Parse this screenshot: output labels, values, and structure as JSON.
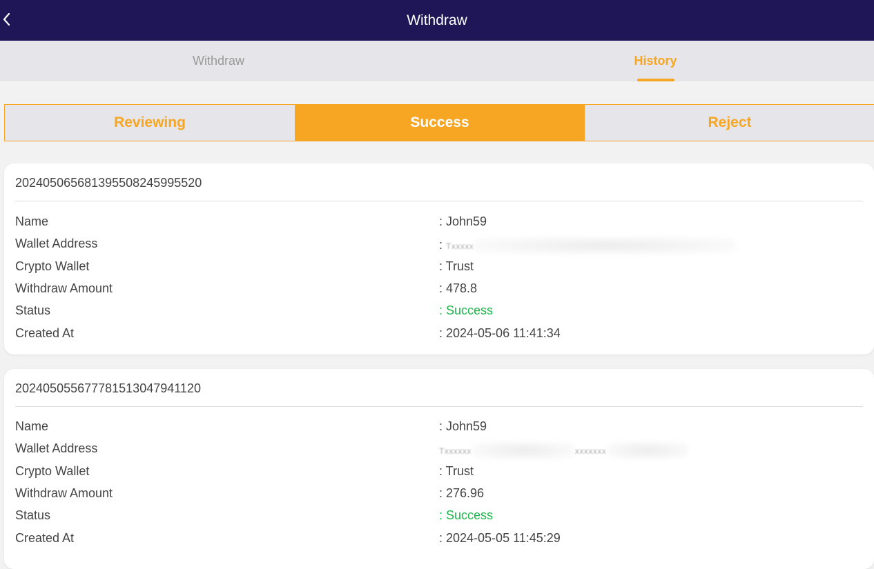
{
  "header": {
    "title": "Withdraw"
  },
  "main_tabs": [
    {
      "label": "Withdraw",
      "active": false
    },
    {
      "label": "History",
      "active": true
    }
  ],
  "sub_tabs": [
    {
      "label": "Reviewing",
      "active": false
    },
    {
      "label": "Success",
      "active": true
    },
    {
      "label": "Reject",
      "active": false
    }
  ],
  "labels": {
    "name": "Name",
    "wallet_address": "Wallet Address",
    "crypto_wallet": "Crypto Wallet",
    "withdraw_amount": "Withdraw Amount",
    "status": "Status",
    "created_at": "Created At"
  },
  "records": [
    {
      "id": "20240506568139550824599552​0",
      "name": ": John59",
      "wallet_address": ": ",
      "crypto_wallet": ": Trust",
      "withdraw_amount": ": 478.8",
      "status": ": Success",
      "created_at": ": 2024-05-06 11:41:34"
    },
    {
      "id": "20240505567778151304794112​0",
      "name": ": John59",
      "wallet_address": "",
      "crypto_wallet": ": Trust",
      "withdraw_amount": ": 276.96",
      "status": ": Success",
      "created_at": ": 2024-05-05 11:45:29"
    }
  ],
  "colors": {
    "header_bg": "#1e1657",
    "accent": "#f6a623",
    "success": "#1cb54a"
  }
}
